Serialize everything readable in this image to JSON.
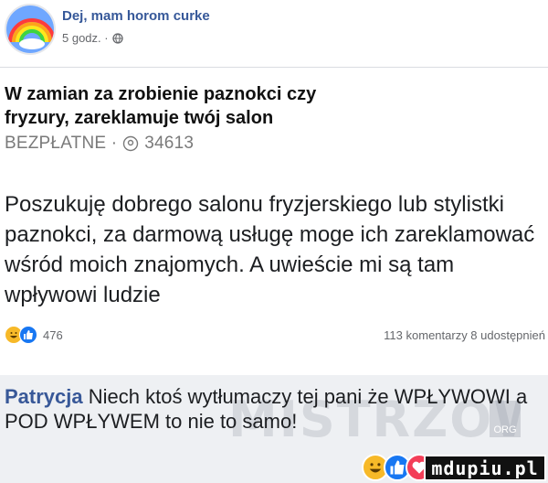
{
  "post": {
    "author": "Dej, mam horom curke",
    "time": "5 godz. ·",
    "card_title": "W zamian za zrobienie paznokci czy fryzury, zareklamuje twój salon",
    "card_tag": "BEZPŁATNE ·",
    "card_views": "34613",
    "body": "Poszukuję dobrego salonu fryzjerskiego lub stylistki paznokci, za darmową usługę moge ich zareklamować wśród moich znajomych. A uwieście mi są tam wpływowi ludzie",
    "reaction_count": "476",
    "stats": "113 komentarzy  8 udostępnień"
  },
  "comment": {
    "author": "Patrycja",
    "text": " Niech ktoś wytłumaczy tej pani że WPŁYWOWI a POD WPŁYWEM to nie to samo!"
  },
  "watermark": {
    "text": "MISTRZOWIE",
    "tag": "ORG"
  },
  "logo": {
    "text": "mdupiu.pl"
  },
  "icons": [
    "globe-icon",
    "location-pin-icon",
    "haha-reaction-icon",
    "like-reaction-icon",
    "love-reaction-icon"
  ],
  "colors": {
    "link": "#385898",
    "like": "#1877f2",
    "love": "#f33e58",
    "haha": "#f7b928"
  }
}
